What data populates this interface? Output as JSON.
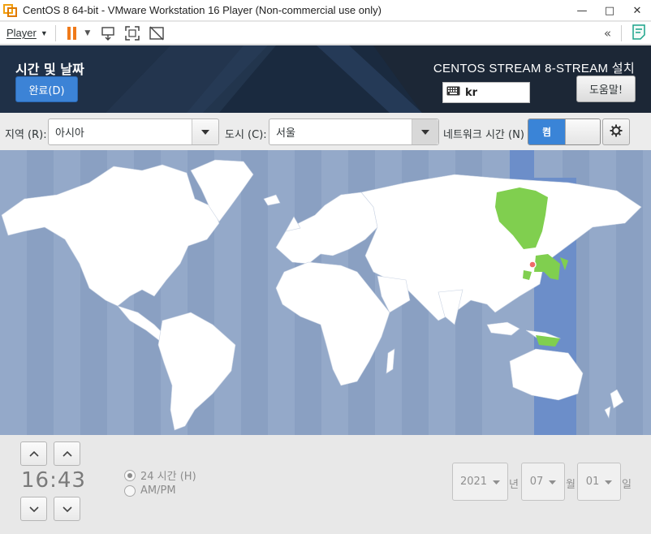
{
  "window": {
    "title": "CentOS 8 64-bit - VMware Workstation 16 Player (Non-commercial use only)",
    "minimize": "—",
    "maximize": "□",
    "close": "✕"
  },
  "vmware": {
    "player_label": "Player",
    "icons": [
      "pause-icon",
      "send-ctrl-alt-del-icon",
      "fullscreen-icon",
      "unity-icon",
      "collapse-icon",
      "notes-icon"
    ],
    "collapse_glyph": "«"
  },
  "header": {
    "spoke_title": "시간 및 날짜",
    "done_label": "완료(D)",
    "product_title": "CENTOS STREAM 8-STREAM 설치",
    "keyboard_layout": "kr",
    "help_label": "도움말!"
  },
  "location": {
    "region_label": "지역 (R):",
    "region_value": "아시아",
    "city_label": "도시 (C):",
    "city_value": "서울",
    "network_time_label": "네트워크 시간 (N)",
    "network_time_state": "켬"
  },
  "time": {
    "hours": "16",
    "separator": ":",
    "minutes": "43",
    "format_24h_label": "24 시간 (H)",
    "format_ampm_label": "AM/PM",
    "selected_format": "24h"
  },
  "date": {
    "year": "2021",
    "year_unit": "년",
    "month": "07",
    "month_unit": "월",
    "day": "01",
    "day_unit": "일"
  },
  "colors": {
    "header_bg": "#1c2736",
    "accent_blue": "#3c83d6",
    "ocean": "#94a9c9",
    "timezone_band": "#6c8ec9",
    "highlight_land": "#80cf4f",
    "land": "#ffffff"
  }
}
